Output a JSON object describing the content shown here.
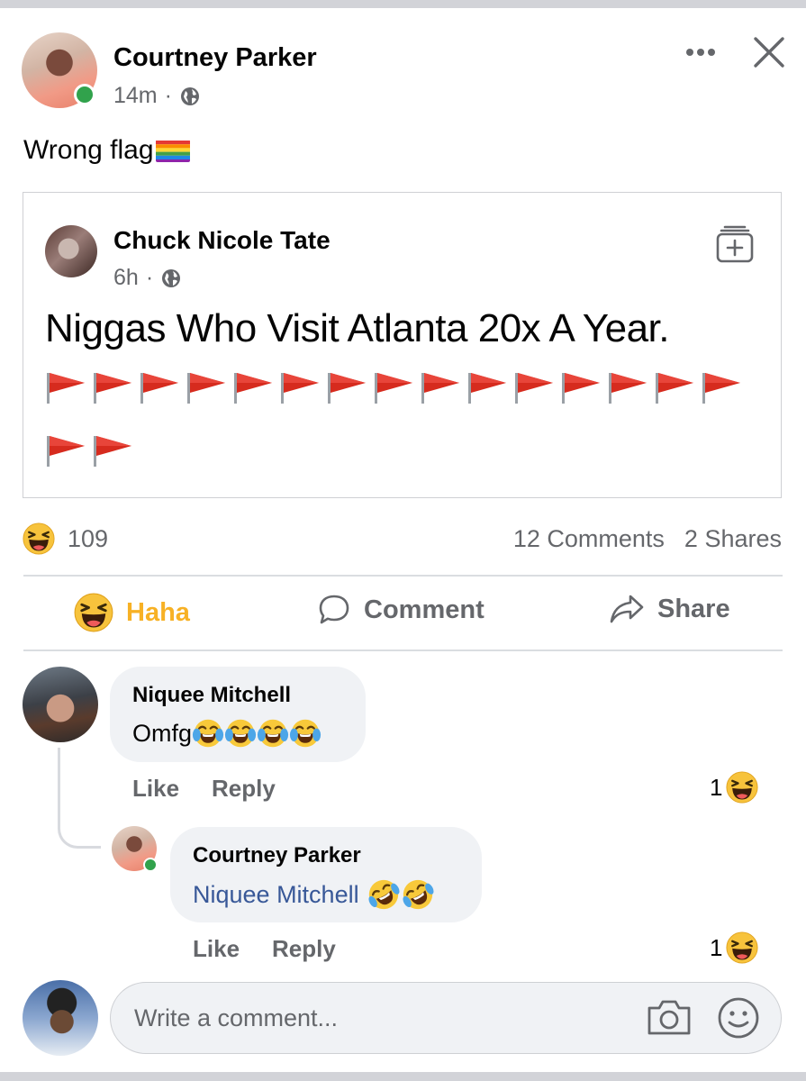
{
  "post": {
    "author": "Courtney Parker",
    "time": "14m",
    "separator": "·",
    "text": "Wrong flag"
  },
  "shared": {
    "author": "Chuck Nicole Tate",
    "time": "6h",
    "separator": "·",
    "text": "Niggas Who Visit Atlanta 20x A Year.",
    "flag_rows": [
      15,
      2
    ]
  },
  "stats": {
    "reaction_count": "109",
    "comments": "12 Comments",
    "shares": "2 Shares"
  },
  "actions": {
    "haha": "Haha",
    "comment": "Comment",
    "share": "Share"
  },
  "comments": [
    {
      "author": "Niquee Mitchell",
      "text": "Omfg",
      "like": "Like",
      "reply": "Reply",
      "reaction_count": "1"
    },
    {
      "author": "Courtney Parker",
      "mention": "Niquee Mitchell",
      "like": "Like",
      "reply": "Reply",
      "reaction_count": "1"
    }
  ],
  "input": {
    "placeholder": "Write a comment..."
  },
  "colors": {
    "online": "#31a24c",
    "haha": "#f7b125",
    "mention": "#385898",
    "secondary_text": "#65676b",
    "flag_red": "#d62b1e"
  },
  "icons": [
    "more-icon",
    "close-icon",
    "globe-icon",
    "save-post-icon",
    "haha-icon",
    "comment-icon",
    "share-icon",
    "camera-icon",
    "sticker-icon",
    "crying-laughing-emoji",
    "rofl-emoji",
    "red-flag-emoji",
    "rainbow-flag-emoji"
  ]
}
